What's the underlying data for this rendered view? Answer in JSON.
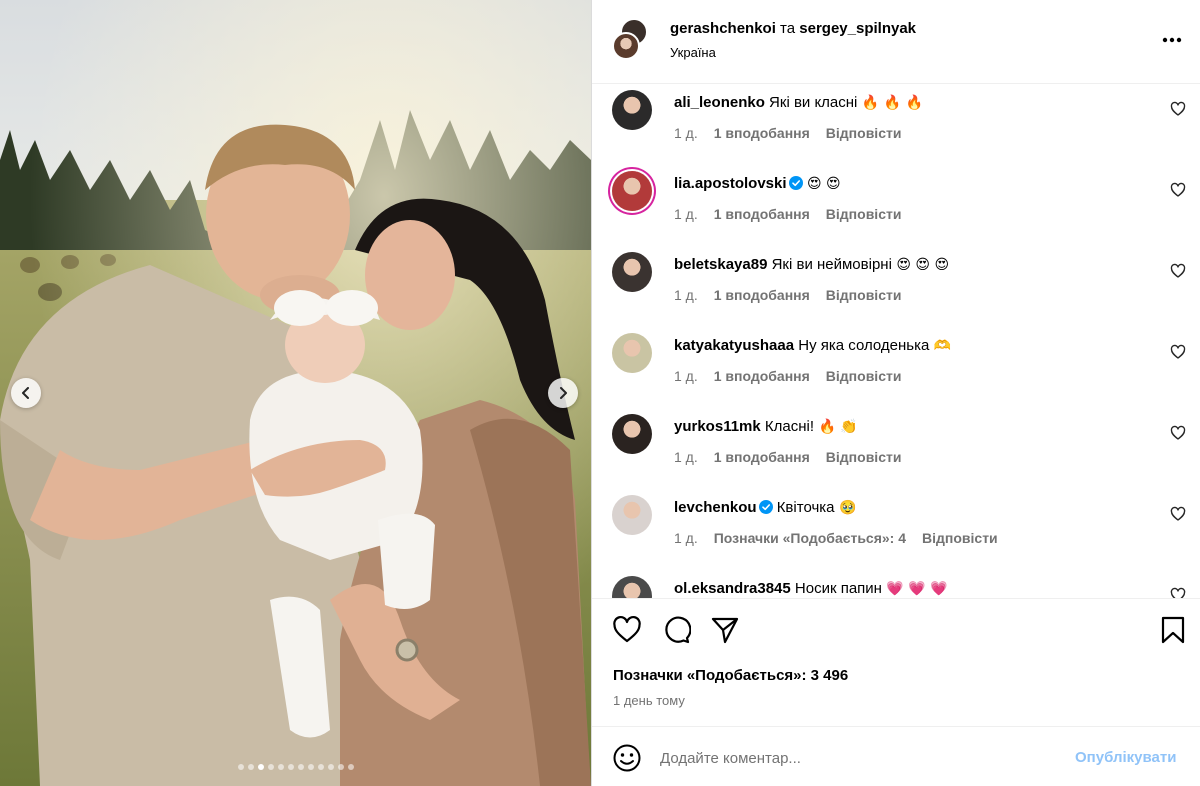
{
  "post": {
    "authors": {
      "first": "gerashchenkoi",
      "joiner": "та",
      "second": "sergey_spilnyak"
    },
    "location": "Україна",
    "more_icon": "more-horizontal-icon"
  },
  "carousel": {
    "slide_count": 12,
    "active_index": 2
  },
  "comments": [
    {
      "user": "ali_leonenko",
      "verified": false,
      "text": "Які ви класні",
      "emoji": "🔥 🔥 🔥",
      "time": "1 д.",
      "likes": "1 вподобання",
      "reply": "Відповісти",
      "avatar_color": "#2b2a2a",
      "story": false
    },
    {
      "user": "lia.apostolovski",
      "verified": true,
      "text": "",
      "emoji": "😍 😍",
      "time": "1 д.",
      "likes": "1 вподобання",
      "reply": "Відповісти",
      "avatar_color": "#b23a3a",
      "story": true
    },
    {
      "user": "beletskaya89",
      "verified": false,
      "text": "Які ви неймовірні",
      "emoji": "😍 😍 😍",
      "time": "1 д.",
      "likes": "1 вподобання",
      "reply": "Відповісти",
      "avatar_color": "#3a3330",
      "story": false
    },
    {
      "user": "katyakatyushaaa",
      "verified": false,
      "text": "Ну яка солоденька",
      "emoji": "🫶",
      "time": "1 д.",
      "likes": "1 вподобання",
      "reply": "Відповісти",
      "avatar_color": "#c9c4a3",
      "story": false
    },
    {
      "user": "yurkos11mk",
      "verified": false,
      "text": "Класні!",
      "emoji": "🔥 👏",
      "time": "1 д.",
      "likes": "1 вподобання",
      "reply": "Відповісти",
      "avatar_color": "#2a2320",
      "story": false
    },
    {
      "user": "levchenkou",
      "verified": true,
      "text": "Квіточка",
      "emoji": "🥹",
      "time": "1 д.",
      "likes": "Позначки «Подобається»: 4",
      "reply": "Відповісти",
      "avatar_color": "#d9d2cf",
      "story": false
    },
    {
      "user": "ol.eksandra3845",
      "verified": false,
      "text": "Носик папин",
      "emoji": "💗 💗 💗",
      "time": "",
      "likes": "",
      "reply": "",
      "avatar_color": "#4a4a4a",
      "story": false
    }
  ],
  "actions": {
    "like_icon": "heart-icon",
    "comment_icon": "comment-icon",
    "share_icon": "share-icon",
    "save_icon": "bookmark-icon",
    "likes_text": "Позначки «Подобається»: 3 496",
    "date_text": "1 день тому"
  },
  "add_comment": {
    "emoji_icon": "emoji-icon",
    "placeholder": "Додайте коментар...",
    "publish_label": "Опублікувати"
  },
  "colors": {
    "accent": "#0095f6",
    "publish_disabled": "#90c3f8",
    "meta_gray": "#737373",
    "verified_blue": "#0095f6"
  }
}
